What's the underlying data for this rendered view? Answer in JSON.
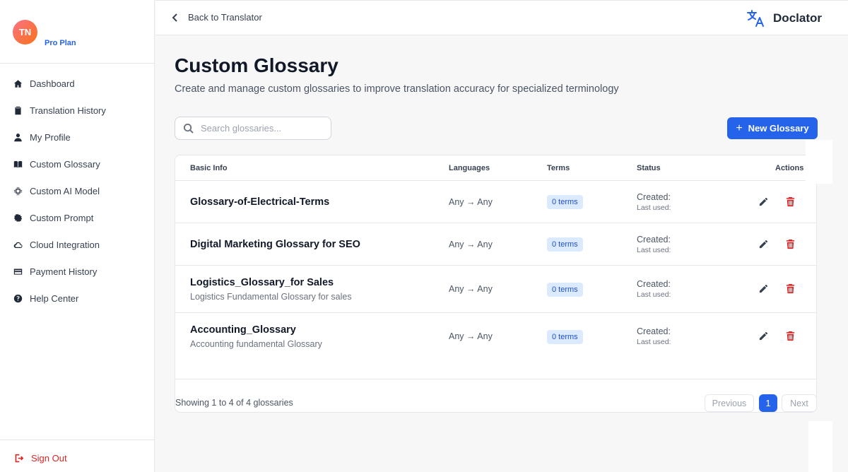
{
  "sidebar": {
    "avatar_initials": "TN",
    "plan": "Pro Plan",
    "items": [
      {
        "label": "Dashboard",
        "icon": "home-icon"
      },
      {
        "label": "Translation History",
        "icon": "clipboard-icon"
      },
      {
        "label": "My Profile",
        "icon": "user-icon"
      },
      {
        "label": "Custom Glossary",
        "icon": "book-icon"
      },
      {
        "label": "Custom AI Model",
        "icon": "chip-icon"
      },
      {
        "label": "Custom Prompt",
        "icon": "gear-icon"
      },
      {
        "label": "Cloud Integration",
        "icon": "cloud-icon"
      },
      {
        "label": "Payment History",
        "icon": "credit-card-icon"
      },
      {
        "label": "Help Center",
        "icon": "help-icon"
      }
    ],
    "signout_label": "Sign Out"
  },
  "header": {
    "back_label": "Back to Translator",
    "brand": "Doclator"
  },
  "main": {
    "title": "Custom Glossary",
    "subtitle": "Create and manage custom glossaries to improve translation accuracy for specialized terminology",
    "search_placeholder": "Search glossaries...",
    "new_button": "New Glossary",
    "columns": {
      "basic_info": "Basic Info",
      "languages": "Languages",
      "terms": "Terms",
      "status": "Status",
      "actions": "Actions"
    },
    "rows": [
      {
        "name": "Glossary-of-Electrical-Terms",
        "desc": "",
        "languages": "Any → Any",
        "terms": "0 terms",
        "created": "Created:",
        "last_used": "Last used:"
      },
      {
        "name": "Digital Marketing Glossary for SEO",
        "desc": "",
        "languages": "Any → Any",
        "terms": "0 terms",
        "created": "Created:",
        "last_used": "Last used:"
      },
      {
        "name": "Logistics_Glossary_for Sales",
        "desc": "Logistics Fundamental Glossary for sales",
        "languages": "Any → Any",
        "terms": "0 terms",
        "created": "Created:",
        "last_used": "Last used:"
      },
      {
        "name": "Accounting_Glossary",
        "desc": "Accounting fundamental Glossary",
        "languages": "Any → Any",
        "terms": "0 terms",
        "created": "Created:",
        "last_used": "Last used:"
      }
    ],
    "footer": "Showing 1 to 4 of 4 glossaries",
    "pagination": {
      "previous": "Previous",
      "current": "1",
      "next": "Next"
    }
  },
  "colors": {
    "accent": "#2563eb",
    "danger": "#dc2626",
    "badge_bg": "#dbeafe"
  }
}
